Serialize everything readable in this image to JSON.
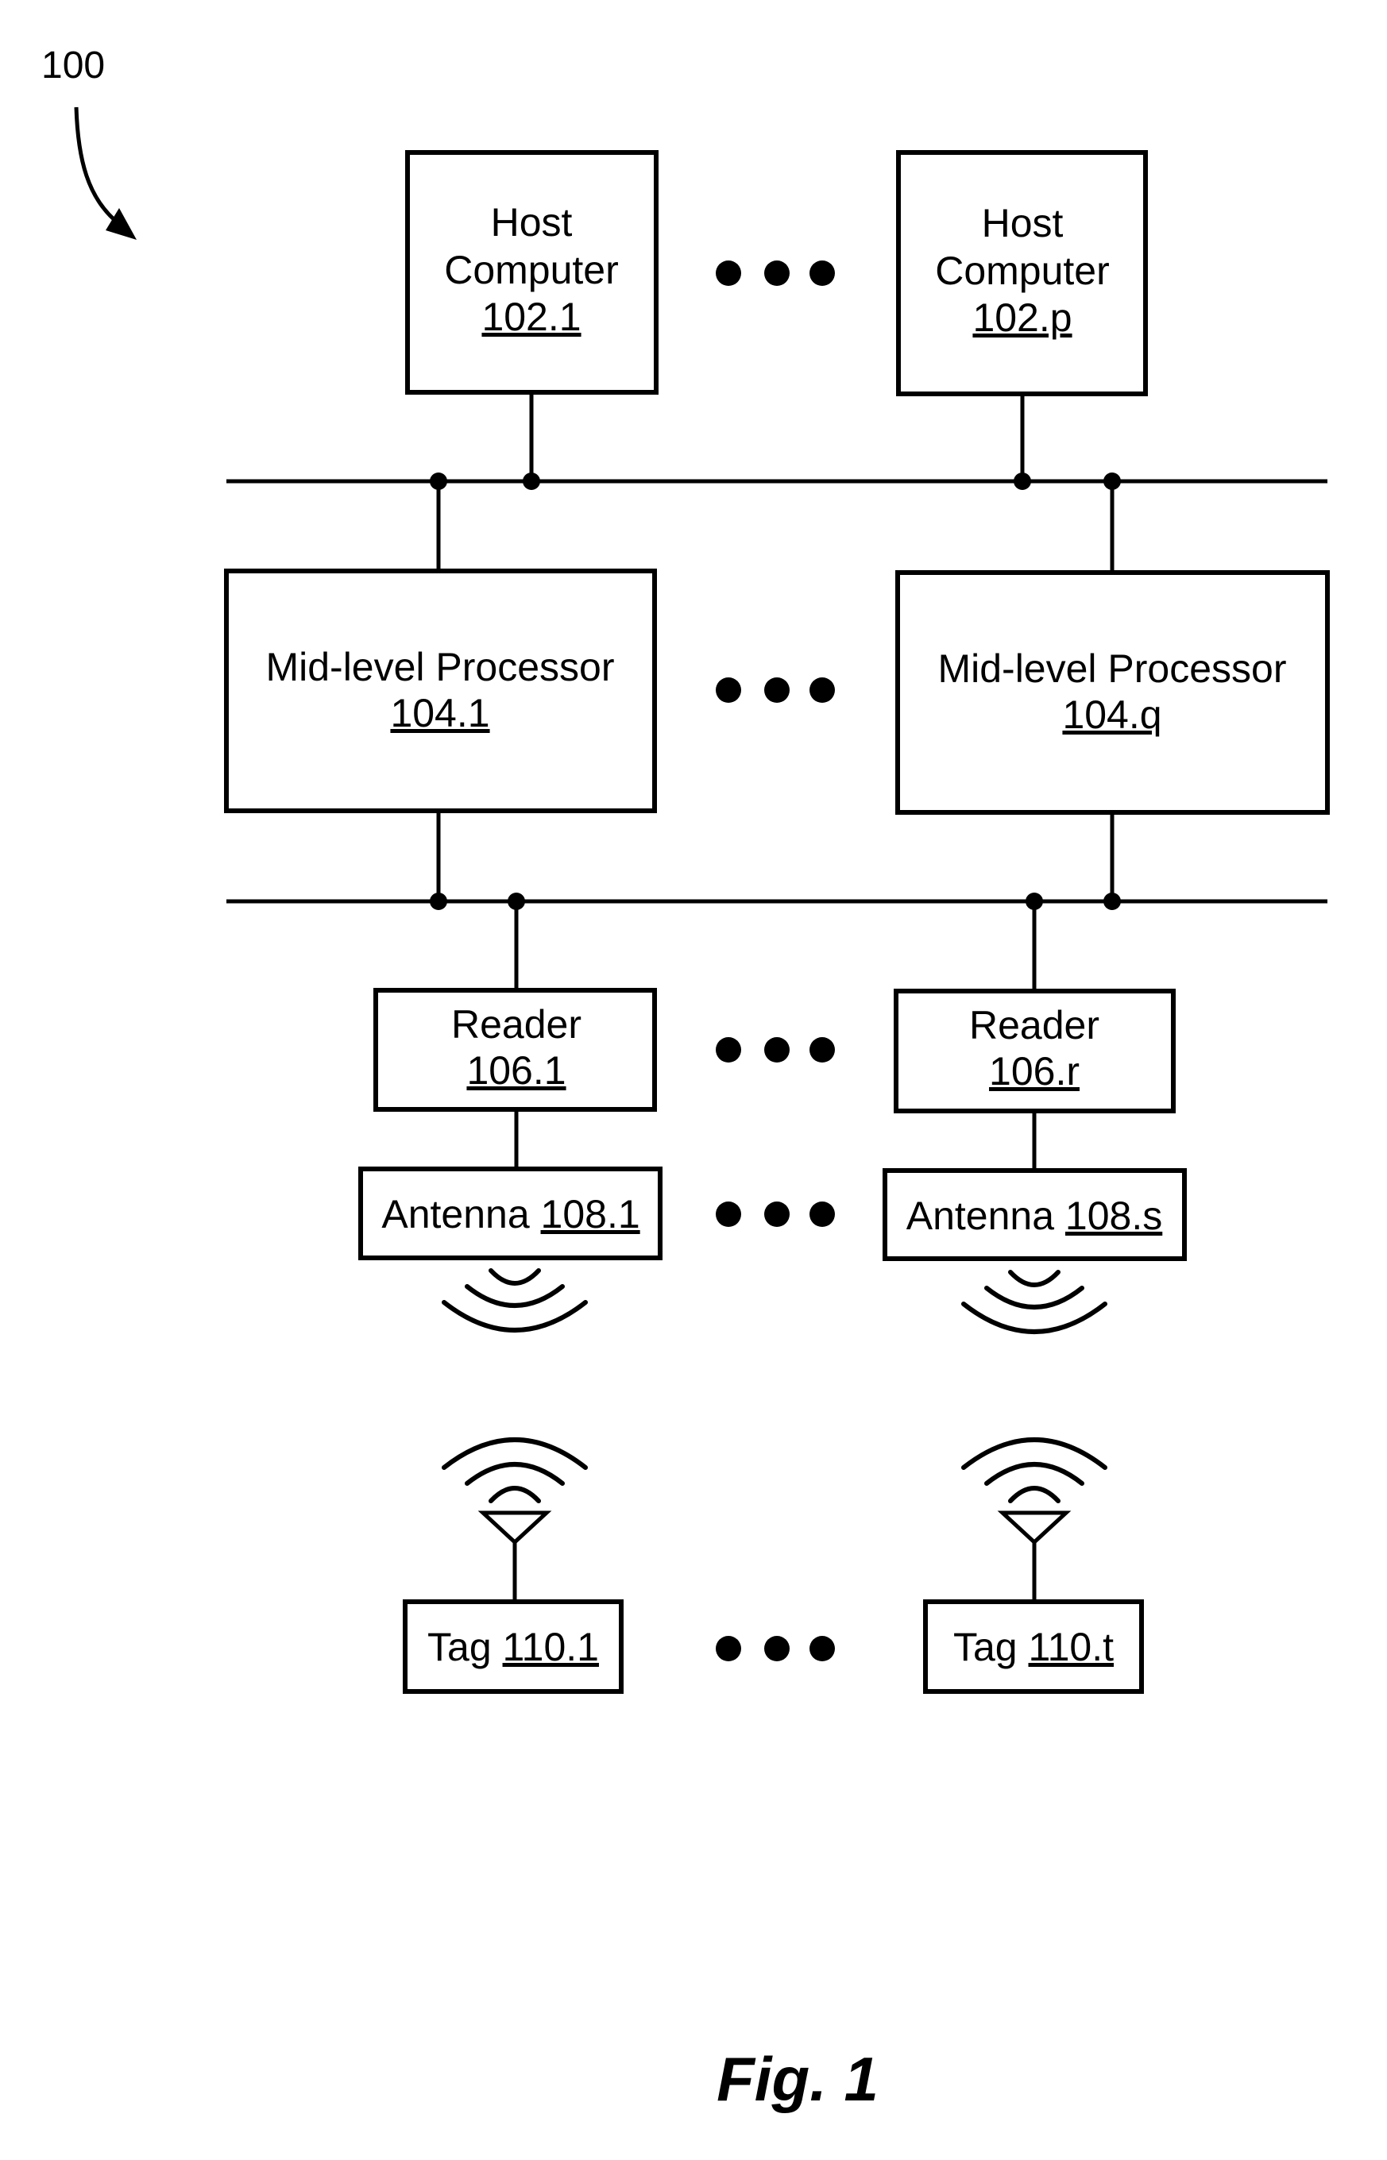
{
  "figure": {
    "reference_numeral": "100",
    "caption": "Fig. 1",
    "ellipsis": "• • •"
  },
  "host_computers": [
    {
      "line1": "Host",
      "line2": "Computer",
      "ref": "102.1"
    },
    {
      "line1": "Host",
      "line2": "Computer",
      "ref": "102.p"
    }
  ],
  "mid_level_processors": [
    {
      "label": "Mid-level Processor",
      "ref": "104.1"
    },
    {
      "label": "Mid-level Processor",
      "ref": "104.q"
    }
  ],
  "readers": [
    {
      "label": "Reader",
      "ref": "106.1"
    },
    {
      "label": "Reader",
      "ref": "106.r"
    }
  ],
  "antennas": [
    {
      "label": "Antenna",
      "ref": "108.1"
    },
    {
      "label": "Antenna",
      "ref": "108.s"
    }
  ],
  "tags": [
    {
      "label": "Tag",
      "ref": "110.1"
    },
    {
      "label": "Tag",
      "ref": "110.t"
    }
  ]
}
